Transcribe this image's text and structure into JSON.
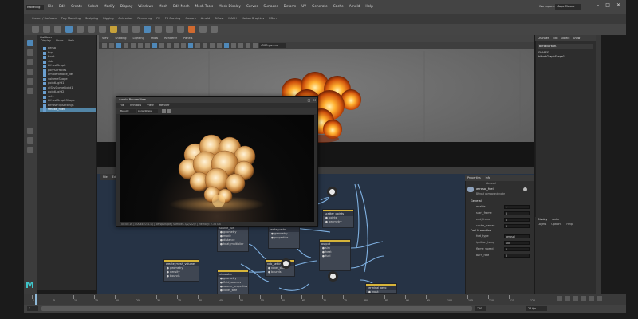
{
  "menubar": {
    "items": [
      "File",
      "Edit",
      "Create",
      "Select",
      "Modify",
      "Display",
      "Windows",
      "Mesh",
      "Edit Mesh",
      "Mesh Tools",
      "Mesh Display",
      "Curves",
      "Surfaces",
      "Deform",
      "UV",
      "Generate",
      "Cache",
      "Arnold",
      "Help"
    ],
    "workspace_label": "Workspace:",
    "workspace_value": "Maya Classic",
    "mode_value": "Modeling"
  },
  "shelf_tabs": [
    "Curves / Surfaces",
    "Poly Modeling",
    "Sculpting",
    "Rigging",
    "Animation",
    "Rendering",
    "FX",
    "FX Caching",
    "Custom",
    "Arnold",
    "Bifrost",
    "MASH",
    "Motion Graphics",
    "XGen"
  ],
  "outliner": {
    "title": "Outliner",
    "menu": [
      "Display",
      "Show",
      "Help"
    ],
    "items": [
      "persp",
      "top",
      "front",
      "side",
      "bifrostGraph",
      "polySurface1",
      "ambientMode_del",
      "volumeShape",
      "pointLight1",
      "aiSkyDomeLight1",
      "pointLight2",
      "set1",
      "bifrostGraphShape",
      "bifrostFlipSettings",
      "smoke_filled"
    ],
    "selected_index": 14
  },
  "viewport": {
    "menu": [
      "View",
      "Shading",
      "Lighting",
      "Show",
      "Renderer",
      "Panels"
    ],
    "camera_field": "sRGB gamma"
  },
  "renderview": {
    "title": "Arnold RenderView",
    "menu": [
      "File",
      "Window",
      "View",
      "Render"
    ],
    "toolbar_camera": "Beauty",
    "toolbar_camera2": "perspShape",
    "status": "00:00:16 | 800x450 (1:1) | perspShape | samples 3/2/2/2/2 | Memory: 2.38 GB"
  },
  "node_editor": {
    "tabs": [
      "File",
      "Edit",
      "View",
      "Graph"
    ],
    "nodes": [
      {
        "title": "volume_start",
        "rows": [
          "geometry",
          "density",
          "heat"
        ]
      },
      {
        "title": "scatter_points",
        "rows": [
          "points",
          "geometry"
        ]
      },
      {
        "title": "source_fuel",
        "rows": [
          "geometry",
          "mode",
          "distance",
          "heat_multiplier"
        ]
      },
      {
        "title": "create_mesh_volume",
        "rows": [
          "geometry",
          "density",
          "bounds"
        ]
      },
      {
        "title": "simulator",
        "rows": [
          "geometry",
          "fluid_sources",
          "source_properties",
          "voxel_size"
        ]
      },
      {
        "title": "vdb_settings",
        "rows": [
          "voxel_size",
          "bounds"
        ]
      },
      {
        "title": "write_cache",
        "rows": [
          "geometry",
          "properties"
        ]
      },
      {
        "title": "output",
        "rows": [
          "sim",
          "heat",
          "fuel"
        ]
      },
      {
        "title": "terminal_aero",
        "rows": [
          "input"
        ]
      }
    ]
  },
  "ne_attributes": {
    "tabs": [
      "Properties",
      "Info"
    ],
    "header": "Aerosol",
    "node_name": "aerosol_fuel",
    "node_sub": "Bifrost compound node",
    "section1": "General",
    "attrs1": [
      {
        "label": "enable",
        "value": "✓"
      },
      {
        "label": "start_frame",
        "value": "0"
      },
      {
        "label": "end_frame",
        "value": "0"
      },
      {
        "label": "cache_frames",
        "value": "0"
      }
    ],
    "section2": "Fuel Properties",
    "attrs2": [
      {
        "label": "fuel_type",
        "value": "aerosol"
      },
      {
        "label": "ignition_temp",
        "value": "100"
      },
      {
        "label": "flame_speed",
        "value": "0"
      },
      {
        "label": "burn_rate",
        "value": "0"
      }
    ]
  },
  "channelbox": {
    "tabs": [
      "Channels",
      "Edit",
      "Object",
      "Show"
    ],
    "name": "bifrostGraph1",
    "shapes_label": "SHAPES",
    "shape_name": "bifrostGraphShape1"
  },
  "layer_editor": {
    "tabs": [
      "Display",
      "Anim"
    ],
    "menu": [
      "Layers",
      "Options",
      "Help"
    ]
  },
  "timeline": {
    "ticks": [
      "1",
      "5",
      "10",
      "15",
      "20",
      "25",
      "30",
      "35",
      "40",
      "45",
      "50",
      "55",
      "60",
      "65",
      "70",
      "75",
      "80",
      "85",
      "90",
      "95",
      "100",
      "105",
      "110",
      "115",
      "120"
    ],
    "current_frame": "1",
    "start": "1",
    "end": "120",
    "fps": "24 fps"
  },
  "colors": {
    "accent": "#5285a6",
    "node_wire": "#7fb0e0",
    "node_header": "#d6b43a",
    "maya_logo": "#3fc5c9"
  }
}
